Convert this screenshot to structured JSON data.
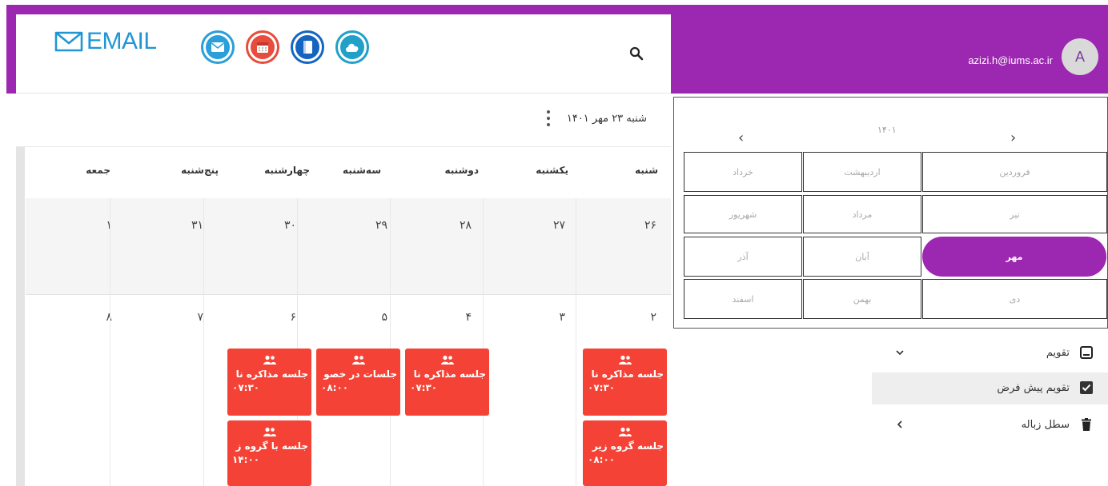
{
  "header": {
    "logo_text": "EMAIL",
    "apps": [
      {
        "name": "mail-app-icon",
        "color": "#2a9fd8"
      },
      {
        "name": "calendar-app-icon",
        "color": "#e74c3c"
      },
      {
        "name": "contacts-app-icon",
        "color": "#1565c0"
      },
      {
        "name": "cloud-app-icon",
        "color": "#21a0c8"
      }
    ],
    "user_email": "azizi.h@iums.ac.ir",
    "avatar_letter": "A",
    "accent_color": "#9c27b0"
  },
  "calendar": {
    "current_date": "شنبه ۲۳ مهر ۱۴۰۱",
    "day_names": [
      "شنبه",
      "یکشنبه",
      "دوشنبه",
      "سه‌شنبه",
      "چهارشنبه",
      "پنج‌شنبه",
      "جمعه"
    ],
    "week1": [
      "۲۶",
      "۲۷",
      "۲۸",
      "۲۹",
      "۳۰",
      "۳۱",
      "۱"
    ],
    "week2": [
      "۲",
      "۳",
      "۴",
      "۵",
      "۶",
      "۷",
      "۸"
    ],
    "events": [
      {
        "title": "جلسه مذاکره نا",
        "time": "۰۷:۳۰",
        "day": "شنبه"
      },
      {
        "title": "جلسه گروه زیر",
        "time": "۰۸:۰۰",
        "day": "شنبه"
      },
      {
        "title": "جلسه مذاکره نا",
        "time": "۰۷:۳۰",
        "day": "دوشنبه"
      },
      {
        "title": "جلسات در خصو",
        "time": "۰۸:۰۰",
        "day": "سه‌شنبه"
      },
      {
        "title": "جلسه مذاکره نا",
        "time": "۰۷:۳۰",
        "day": "چهارشنبه"
      },
      {
        "title": "جلسه با گروه ز",
        "time": "۱۴:۰۰",
        "day": "چهارشنبه"
      }
    ],
    "event_color": "#f44336"
  },
  "mini_calendar": {
    "year": "۱۴۰۱",
    "prev": "‹",
    "next": "›",
    "months": [
      "فروردین",
      "اردیبهشت",
      "خرداد",
      "تیر",
      "مرداد",
      "شهریور",
      "مهر",
      "آبان",
      "آذر",
      "دی",
      "بهمن",
      "اسفند"
    ],
    "selected_month": "مهر"
  },
  "sidebar": {
    "calendars_label": "تقویم",
    "default_calendar_label": "تقویم پیش فرض",
    "default_calendar_checked": true,
    "trash_label": "سطل زباله"
  }
}
